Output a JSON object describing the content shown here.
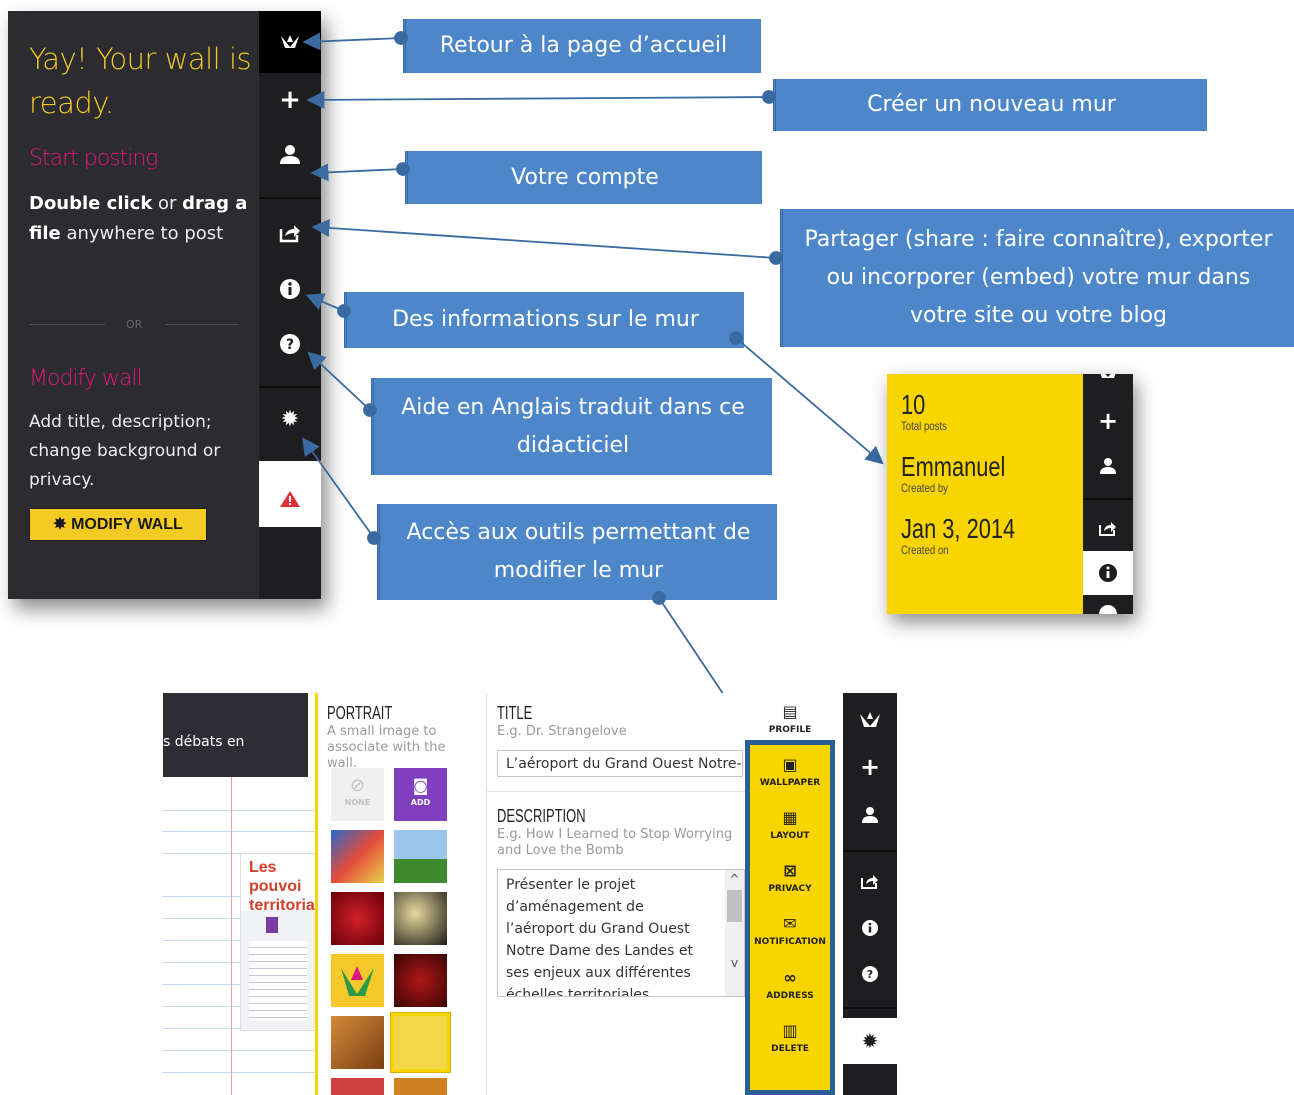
{
  "welcome_panel": {
    "title": "Yay! Your wall is ready.",
    "start_heading": "Start posting",
    "instruction_bold1": "Double click",
    "instruction_or": " or ",
    "instruction_bold2": "drag a file",
    "instruction_rest": " anywhere to post",
    "or_divider": "OR",
    "modify_heading": "Modify wall",
    "modify_text": "Add title, description; change background or privacy.",
    "modify_button": "MODIFY WALL"
  },
  "sidebar": {
    "icons": [
      "home-origami-icon",
      "plus-icon",
      "user-icon",
      "share-icon",
      "info-icon",
      "help-icon",
      "gear-icon",
      "alert-icon"
    ]
  },
  "callouts": {
    "home": "Retour à la page d’accueil",
    "new_wall": "Créer un nouveau mur",
    "account": "Votre compte",
    "share": "Partager (share : faire connaître), exporter ou incorporer (embed) votre mur dans votre site ou votre blog",
    "info": "Des informations sur le mur",
    "help": "Aide en Anglais traduit dans ce didacticiel",
    "tools": "Accès aux outils permettant de modifier le mur"
  },
  "info_card": {
    "posts_value": "10",
    "posts_label": "Total posts",
    "author_value": "Emmanuel",
    "author_label": "Created by",
    "date_value": "Jan 3, 2014",
    "date_label": "Created on"
  },
  "settings_panel": {
    "bg_post_text": "s débats en",
    "wall_post_title": "Les pouvoi territoriale",
    "portrait": {
      "title": "PORTRAIT",
      "hint": "A small image to associate with the wall.",
      "none_label": "NONE",
      "add_label": "ADD"
    },
    "title_section": {
      "title": "TITLE",
      "placeholder": "E.g. Dr. Strangelove",
      "value": "L’aéroport du Grand Ouest Notre-D"
    },
    "description_section": {
      "title": "DESCRIPTION",
      "placeholder": "E.g. How I Learned to Stop Worrying and Love the Bomb",
      "value": "Présenter le projet d’aménagement de l’aéroport du Grand Ouest Notre Dame des Landes et ses enjeux aux différentes échelles territoriales, localiser le territoire, identifier"
    },
    "menu": [
      "PROFILE",
      "WALLPAPER",
      "LAYOUT",
      "PRIVACY",
      "NOTIFICATION",
      "ADDRESS",
      "DELETE"
    ]
  },
  "colors": {
    "callout_blue": "#4e87c9",
    "padlet_yellow": "#f9d500",
    "padlet_pink": "#e0177d",
    "padlet_dark": "#2b2b30"
  }
}
